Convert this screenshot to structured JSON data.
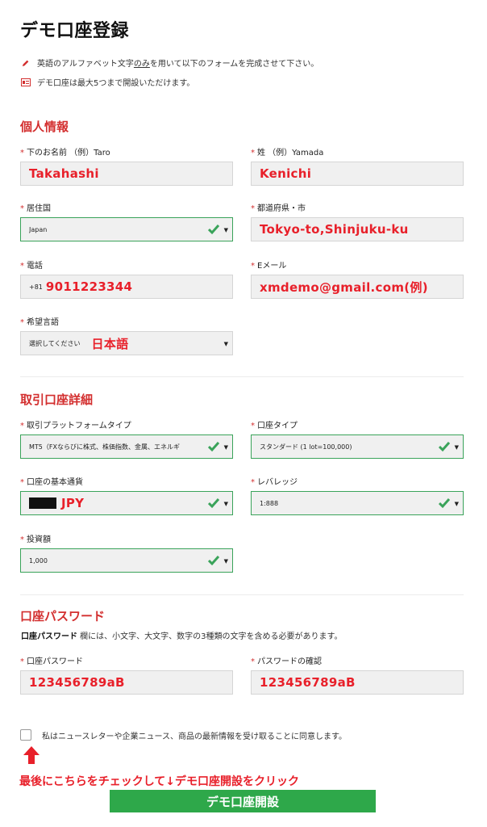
{
  "title": "デモ口座登録",
  "notes": {
    "alphabet_pre": "英語のアルファベット文字",
    "alphabet_u": "のみ",
    "alphabet_post": "を用いて以下のフォームを完成させて下さい。",
    "limit": "デモ口座は最大5つまで開設いただけます。"
  },
  "personal": {
    "heading": "個人情報",
    "first_name": {
      "label": "下のお名前 （例）Taro",
      "value": "Takahashi"
    },
    "last_name": {
      "label": "姓 （例）Yamada",
      "value": "Kenichi"
    },
    "country": {
      "label": "居住国",
      "value": "Japan"
    },
    "city": {
      "label": "都道府県・市",
      "value": "Tokyo-to,Shinjuku-ku"
    },
    "phone": {
      "label": "電話",
      "code": "+81",
      "value": "9011223344"
    },
    "email": {
      "label": "Eメール",
      "value": "xmdemo@gmail.com(例)"
    },
    "language": {
      "label": "希望言語",
      "placeholder": "選択してください",
      "value": "日本語"
    }
  },
  "trading": {
    "heading": "取引口座詳細",
    "platform": {
      "label": "取引プラットフォームタイプ",
      "value": "MT5（FXならびに株式、株価指数、金属、エネルギ"
    },
    "account_type": {
      "label": "口座タイプ",
      "value": "スタンダード (1 lot=100,000)"
    },
    "currency": {
      "label": "口座の基本通貨",
      "value": "JPY"
    },
    "leverage": {
      "label": "レバレッジ",
      "value": "1:888"
    },
    "investment": {
      "label": "投資額",
      "value": "1,000"
    }
  },
  "password": {
    "heading": "口座パスワード",
    "desc_bold": "口座パスワード",
    "desc_rest": " 欄には、小文字、大文字、数字の3種類の文字を含める必要があります。",
    "password": {
      "label": "口座パスワード",
      "value": "123456789aB"
    },
    "confirm": {
      "label": "パスワードの確認",
      "value": "123456789aB"
    }
  },
  "consent": "私はニュースレターや企業ニュース、商品の最新情報を受け取ることに同意します。",
  "instruction": "最後にこちらをチェックして↓デモ口座開設をクリック",
  "submit_label": "デモ口座開設",
  "colors": {
    "accent_red": "#d32f2f",
    "value_red": "#e8202a",
    "valid_green": "#3aa35a",
    "button_green": "#2ea84a"
  },
  "icons": {
    "note1": "pencil-icon",
    "note2": "id-card-icon",
    "valid": "check-icon",
    "dropdown": "caret-down-icon",
    "pointer": "arrow-up-icon"
  }
}
